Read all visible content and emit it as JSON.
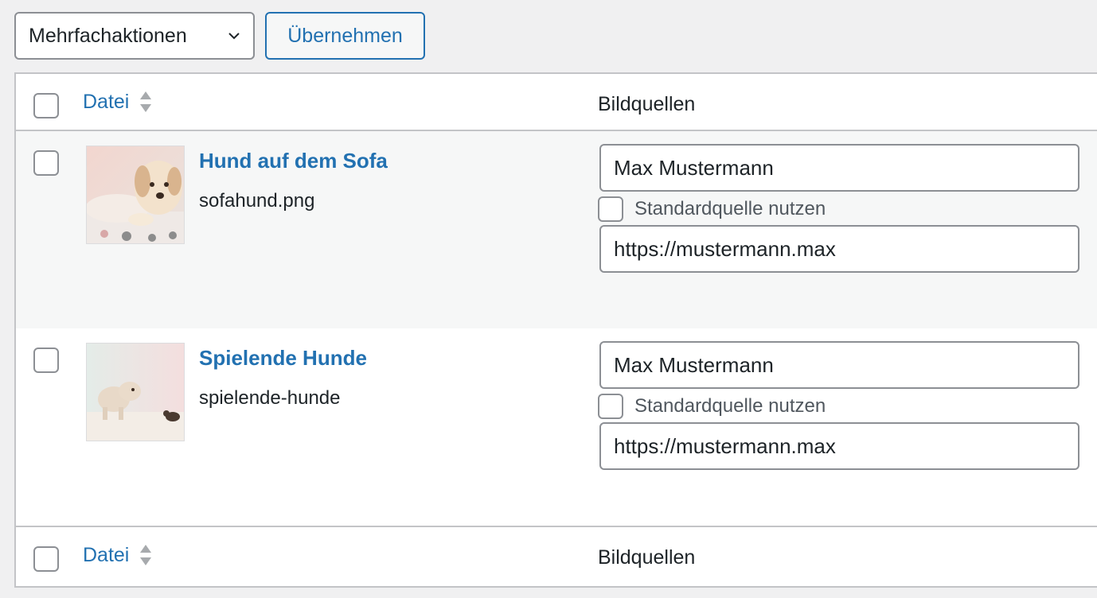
{
  "toolbar": {
    "bulk_select_value": "Mehrfachaktionen",
    "apply_label": "Übernehmen"
  },
  "table": {
    "columns": {
      "file": "Datei",
      "sources": "Bildquellen"
    },
    "rows": [
      {
        "title": "Hund auf dem Sofa",
        "filename": "sofahund.png",
        "source_name": "Max Mustermann",
        "use_default_label": "Standardquelle nutzen",
        "source_url": "https://mustermann.max"
      },
      {
        "title": "Spielende Hunde",
        "filename": "spielende-hunde",
        "source_name": "Max Mustermann",
        "use_default_label": "Standardquelle nutzen",
        "source_url": "https://mustermann.max"
      }
    ]
  },
  "icons": {
    "bulk_select": "chevron-down-icon",
    "sort": "sort-icon"
  },
  "colors": {
    "accent": "#2271b1",
    "background": "#f0f0f1",
    "row_alt": "#f6f7f7",
    "border": "#c3c4c7"
  }
}
